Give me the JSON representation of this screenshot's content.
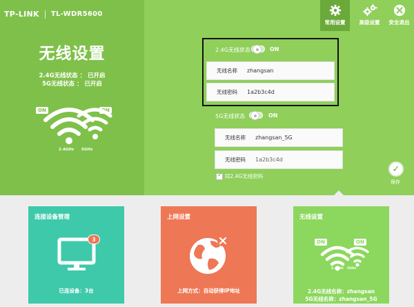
{
  "brand": {
    "logo": "TP-LINK",
    "model": "TL-WDR5600"
  },
  "topnav": [
    {
      "label": "常用设置",
      "icon": "gear-icon",
      "active": true
    },
    {
      "label": "高级设置",
      "icon": "gears-icon",
      "active": false
    },
    {
      "label": "安全退出",
      "icon": "close-icon",
      "active": false
    }
  ],
  "left": {
    "title": "无线设置",
    "status_24": "2.4G无线状态 ： 已开启",
    "status_5": "5G无线状态 ： 已开启",
    "badge_on_left": "ON",
    "badge_on_right": "ON",
    "band_24": "2.4GHz",
    "band_5": "5GHz"
  },
  "form": {
    "band24": {
      "state_label": "2.4G无线状态",
      "toggle_text": "ON",
      "name_label": "无线名称",
      "name_value": "zhangsan",
      "pwd_label": "无线密码",
      "pwd_value": "1a2b3c4d"
    },
    "band5": {
      "state_label": "5G无线状态",
      "toggle_text": "ON",
      "name_label": "无线名称",
      "name_value": "zhangsan_5G",
      "pwd_label": "无线密码",
      "pwd_value": "1a2b3c4d"
    },
    "same_pwd_label": "同2.4G无线密码",
    "same_pwd_checked": true,
    "save_label": "保存"
  },
  "cards": {
    "devices": {
      "title": "连接设备管理",
      "badge": "3",
      "footer": "已连设备：3台"
    },
    "internet": {
      "title": "上网设置",
      "footer": "上网方式：自动获得IP地址"
    },
    "wireless": {
      "title": "无线设置",
      "badge_left": "ON",
      "badge_right": "ON",
      "band_24": "2.4GHz",
      "band_5": "5GHz",
      "footer_24": "2.4G无线名称：zhangsan",
      "footer_5": "5G无线名称：zhangsan_5G"
    }
  },
  "colors": {
    "green_top": "#8fcf5a",
    "green_left": "#7fc04a",
    "card_teal": "#3ec9aa",
    "card_orange": "#ee7755",
    "card_green": "#8cd75e"
  }
}
